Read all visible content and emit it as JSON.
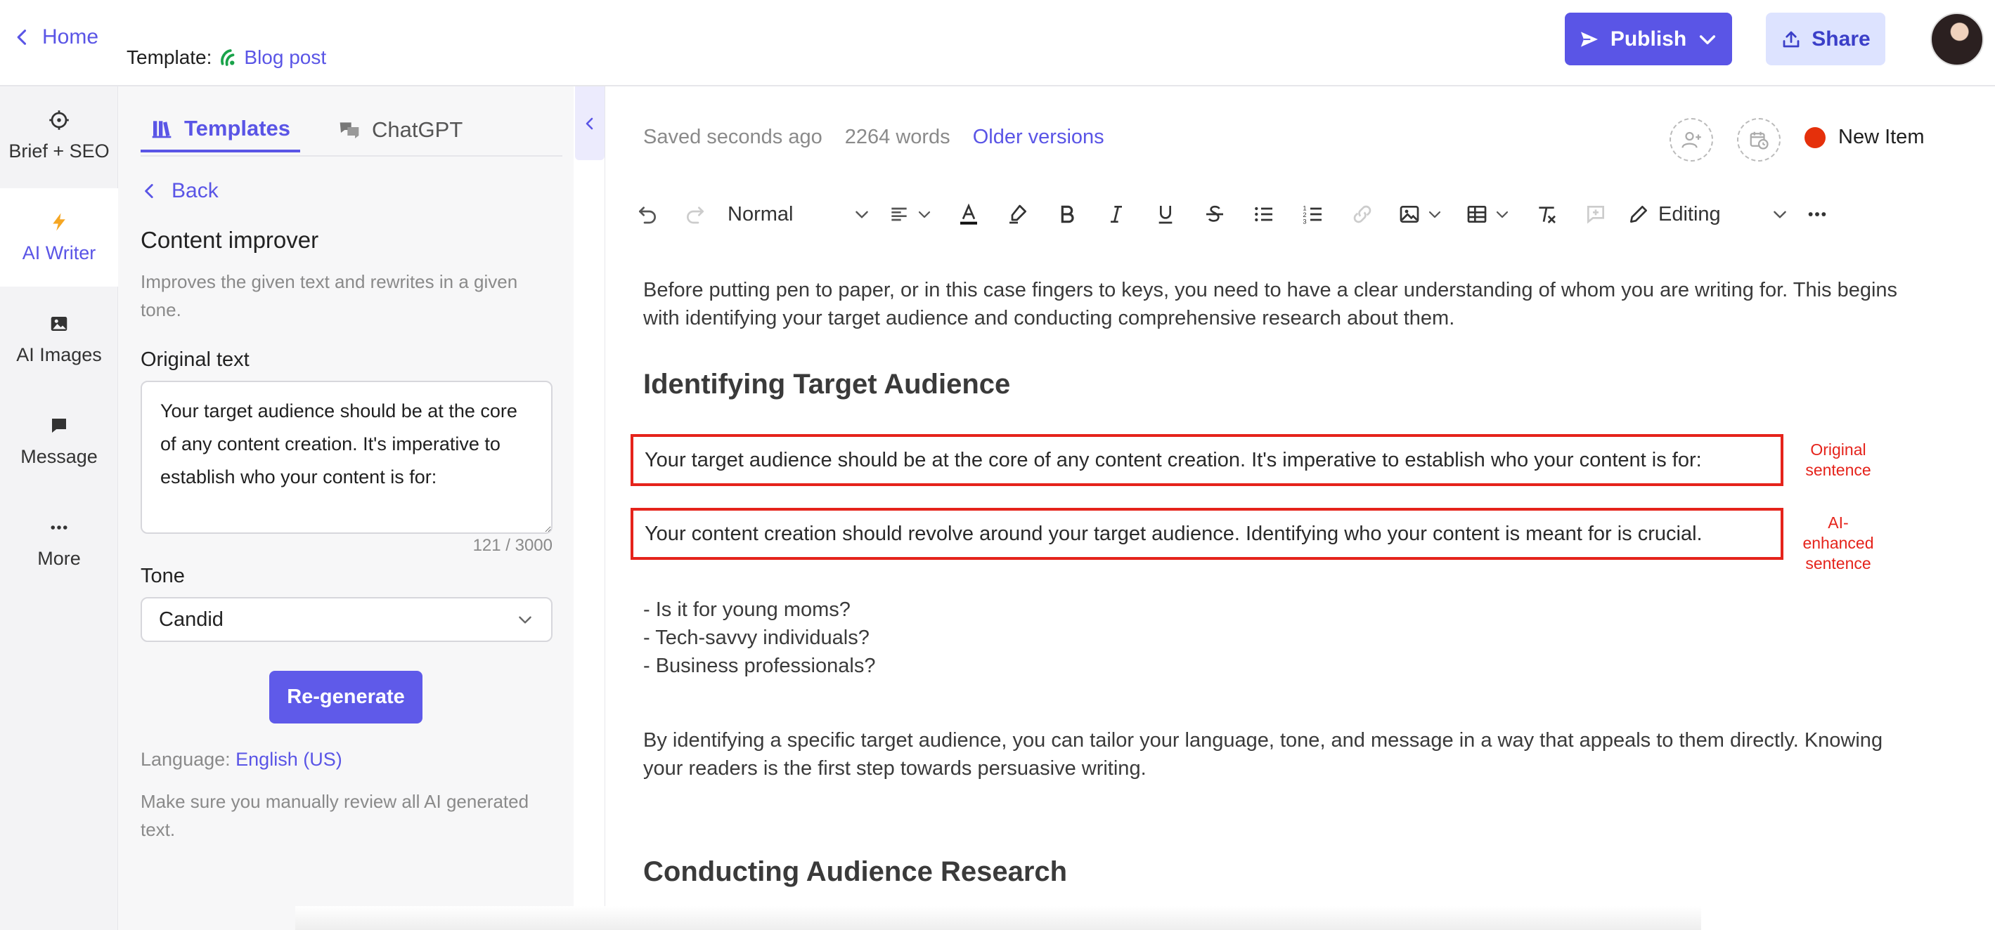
{
  "header": {
    "home_label": "Home",
    "template_prefix": "Template:",
    "template_name": "Blog post",
    "publish_label": "Publish",
    "share_label": "Share"
  },
  "rail": {
    "items": [
      {
        "label": "Brief + SEO",
        "icon": "crosshair-icon"
      },
      {
        "label": "AI Writer",
        "icon": "lightning-icon",
        "active": true
      },
      {
        "label": "AI Images",
        "icon": "image-icon"
      },
      {
        "label": "Message",
        "icon": "chat-bubble-icon"
      },
      {
        "label": "More",
        "icon": "ellipsis-icon"
      }
    ]
  },
  "panel": {
    "tabs": [
      {
        "label": "Templates",
        "icon": "books-icon",
        "active": true
      },
      {
        "label": "ChatGPT",
        "icon": "chat-bubbles-icon"
      }
    ],
    "back_label": "Back",
    "title": "Content improver",
    "description": "Improves the given text and rewrites in a given tone.",
    "original_label": "Original text",
    "original_value": "Your target audience should be at the core of any content creation. It's imperative to establish who your content is for:",
    "counter": "121 / 3000",
    "tone_label": "Tone",
    "tone_value": "Candid",
    "regenerate_label": "Re-generate",
    "language_prefix": "Language:",
    "language_value": "English (US)",
    "disclaimer": "Make sure you manually review all AI generated text."
  },
  "editor": {
    "saved_status": "Saved seconds ago",
    "word_count": "2264 words",
    "older_versions": "Older versions",
    "new_item_label": "New Item",
    "toolbar": {
      "style_value": "Normal",
      "mode_value": "Editing"
    },
    "paragraph_1": "Before putting pen to paper, or in this case fingers to keys, you need to have a clear understanding of whom you are writing for. This begins with identifying your target audience and conducting comprehensive research about them.",
    "heading_1": "Identifying Target Audience",
    "original_sentence": "Your target audience should be at the core of any content creation. It's imperative to establish who your content is for:",
    "enhanced_sentence": "Your content creation should revolve around your target audience. Identifying who your content is meant for is crucial.",
    "annotation_original": "Original sentence",
    "annotation_enhanced": "AI-enhanced sentence",
    "list": [
      "- Is it for young moms?",
      "- Tech-savvy individuals?",
      "- Business professionals?"
    ],
    "paragraph_2": "By identifying a specific target audience, you can tailor your language, tone, and message in a way that appeals to them directly. Knowing your readers is the first step towards persuasive writing.",
    "heading_2": "Conducting Audience Research"
  },
  "colors": {
    "accent": "#5a55e6",
    "highlight_red": "#e5231b",
    "status_dot": "#e5300b"
  }
}
